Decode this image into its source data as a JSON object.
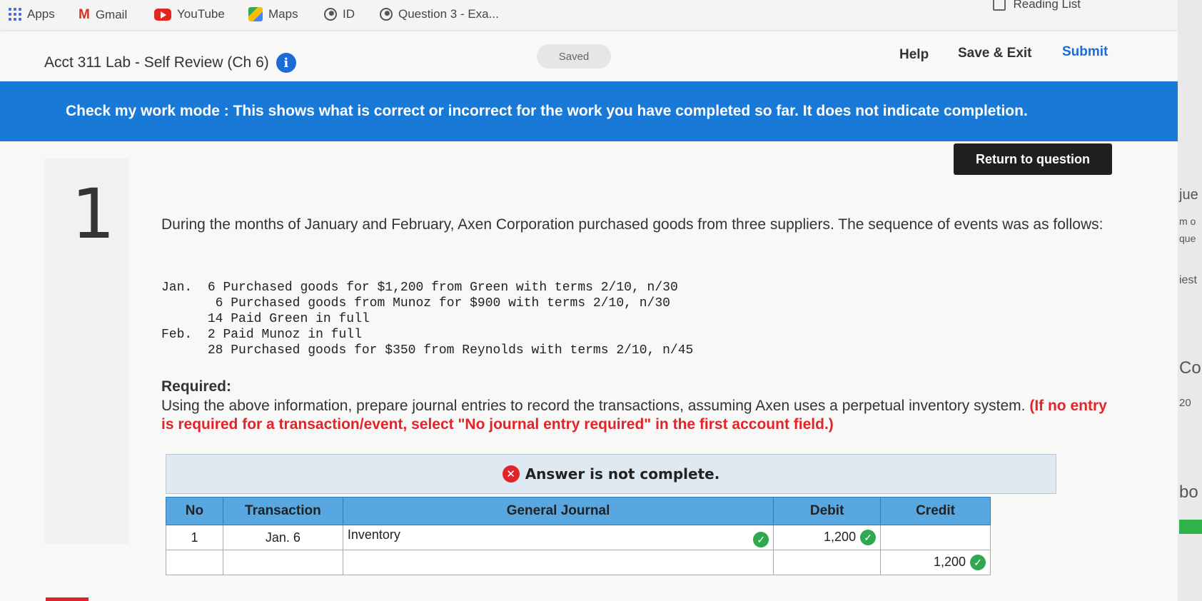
{
  "bookmarks": {
    "items": [
      "Apps",
      "Gmail",
      "YouTube",
      "Maps",
      "ID",
      "Question 3 - Exa..."
    ],
    "reading_list": "Reading List"
  },
  "header": {
    "title": "Acct 311 Lab - Self Review (Ch 6)",
    "saved": "Saved",
    "help": "Help",
    "save_exit": "Save & Exit",
    "submit": "Submit"
  },
  "banner": "Check my work mode : This shows what is correct or incorrect for the work you have completed so far. It does not indicate completion.",
  "return_button": "Return to question",
  "question": {
    "number": "1",
    "prompt": "During the months of January and February, Axen Corporation purchased goods from three suppliers. The sequence of events was as follows:",
    "events": [
      {
        "month": "Jan.",
        "day": "6",
        "text": "Purchased goods for $1,200 from Green with terms 2/10, n/30"
      },
      {
        "month": "",
        "day": "6",
        "text": "Purchased goods from Munoz for $900 with terms 2/10, n/30"
      },
      {
        "month": "",
        "day": "14",
        "text": "Paid Green in full"
      },
      {
        "month": "Feb.",
        "day": "2",
        "text": "Paid Munoz in full"
      },
      {
        "month": "",
        "day": "28",
        "text": "Purchased goods for $350 from Reynolds with terms 2/10, n/45"
      }
    ],
    "required_heading": "Required:",
    "required_text": "Using the above information, prepare journal entries to record the transactions, assuming Axen uses a perpetual inventory system.",
    "required_note": "(If no entry is required for a transaction/event, select \"No journal entry required\" in the first account field.)"
  },
  "answer": {
    "status": "Answer is not complete.",
    "columns": [
      "No",
      "Transaction",
      "General Journal",
      "Debit",
      "Credit"
    ],
    "rows": [
      {
        "no": "1",
        "transaction": "Jan. 6",
        "account": "Inventory",
        "debit": "1,200",
        "credit": ""
      },
      {
        "no": "",
        "transaction": "",
        "account": "",
        "debit": "",
        "credit": "1,200"
      }
    ]
  },
  "side_fragments": [
    "jue",
    "m o",
    "que",
    "iest",
    "Cor",
    "20",
    "bo"
  ]
}
